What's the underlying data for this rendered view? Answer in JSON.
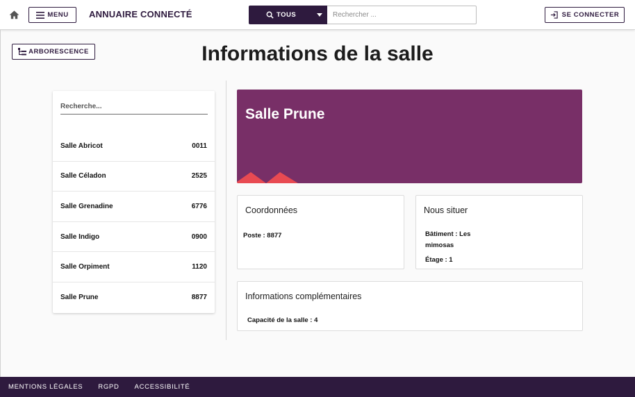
{
  "header": {
    "menu_label": "MENU",
    "app_title": "ANNUAIRE CONNECTÉ",
    "scope_label": "TOUS",
    "search_placeholder": "Rechercher ...",
    "login_label": "SE CONNECTER"
  },
  "toolbar": {
    "tree_label": "ARBORESCENCE"
  },
  "page": {
    "title": "Informations de la salle"
  },
  "room_list": {
    "search_placeholder": "Recherche...",
    "items": [
      {
        "name": "Salle Abricot",
        "code": "0011"
      },
      {
        "name": "Salle Céladon",
        "code": "2525"
      },
      {
        "name": "Salle Grenadine",
        "code": "6776"
      },
      {
        "name": "Salle Indigo",
        "code": "0900"
      },
      {
        "name": "Salle Orpiment",
        "code": "1120"
      },
      {
        "name": "Salle Prune",
        "code": "8877"
      }
    ]
  },
  "room": {
    "name": "Salle Prune",
    "banner_color": "#782f67",
    "accent_color": "#e84a52"
  },
  "coordinates": {
    "title": "Coordonnées",
    "poste": "Poste : 8877"
  },
  "location": {
    "title": "Nous situer",
    "batiment_line1": "Bâtiment : Les",
    "batiment_line2": "mimosas",
    "etage": "Étage : 1"
  },
  "extra": {
    "title": "Informations complémentaires",
    "capacity": "Capacité de la salle : 4"
  },
  "footer": {
    "links": [
      "MENTIONS LÉGALES",
      "RGPD",
      "ACCESSIBILITÉ"
    ]
  },
  "colors": {
    "primary": "#2e1a3e"
  }
}
